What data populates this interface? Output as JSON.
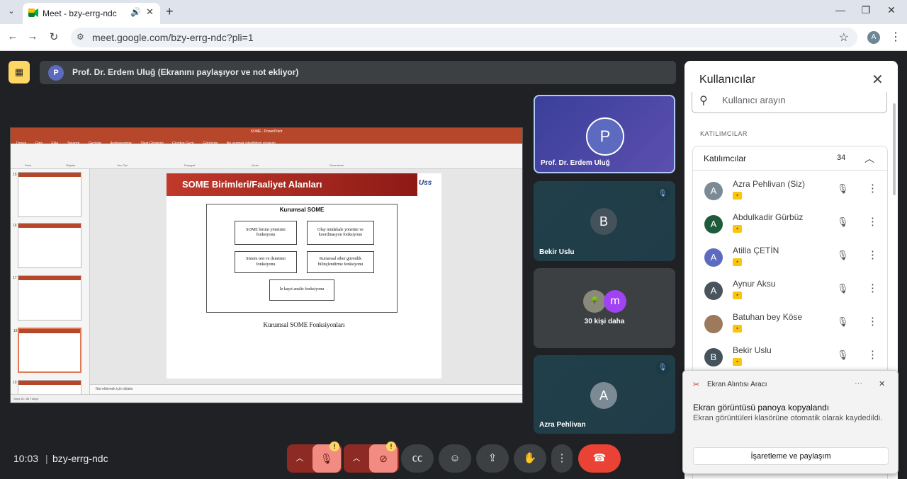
{
  "browser": {
    "tab_title": "Meet - bzy-errg-ndc",
    "url": "meet.google.com/bzy-errg-ndc?pli=1",
    "profile_initial": "A"
  },
  "presenter": {
    "initial": "P",
    "text": "Prof. Dr. Erdem Uluğ (Ekranını paylaşıyor ve not ekliyor)"
  },
  "shared_screen": {
    "window_title": "SOME - PowerPoint",
    "menu": [
      "Dosya",
      "Giriş",
      "Ekle",
      "Tasarım",
      "Geçişler",
      "Animasyonlar",
      "Slayt Gösterisi",
      "Gözden Geçir",
      "Görünüm",
      "Ne yapmak istediğinizi söyleyin..."
    ],
    "ribbon_groups": [
      "Pano",
      "Slaytlar",
      "Yazı Tipi",
      "Paragraf",
      "Çizim",
      "Düzenleme"
    ],
    "thumb_numbers": [
      "15",
      "16",
      "17",
      "18",
      "19"
    ],
    "slide": {
      "title": "SOME Birimleri/Faaliyet Alanları",
      "logo": "Uss",
      "box_title": "Kurumsal SOME",
      "boxes": [
        "SOME birimi yönetimi fonksiyonu",
        "Olay müdahale yönetim ve koordinasyon fonksiyonu",
        "Sistem test ve denetimi fonksiyonu",
        "Kurumsal siber güvenlik bilinçlendirme fonksiyonu",
        "İz kayıt analiz fonksiyonu"
      ],
      "caption": "Kurumsal SOME Fonksiyonları"
    },
    "notes": "Not eklemek için tıklatın",
    "status": "Slayt 18 / 56   Türkçe"
  },
  "tiles": [
    {
      "name": "Prof. Dr. Erdem Uluğ",
      "initial": "P"
    },
    {
      "name": "Bekir Uslu",
      "initial": "B"
    },
    {
      "name": "30 kişi daha",
      "initial": "m"
    },
    {
      "name": "Azra Pehlivan",
      "initial": "A"
    }
  ],
  "panel": {
    "title": "Kullanıcılar",
    "search_placeholder": "Kullanıcı arayın",
    "section_label": "KATILIMCILAR",
    "list_label": "Katılımcılar",
    "count": "34",
    "people": [
      {
        "name": "Azra Pehlivan (Siz)",
        "initial": "A",
        "color": "#7b8a95"
      },
      {
        "name": "Abdulkadir Gürbüz",
        "initial": "A",
        "color": "#1e5b3a"
      },
      {
        "name": "Atilla ÇETİN",
        "initial": "A",
        "color": "#5c6bc0"
      },
      {
        "name": "Aynur Aksu",
        "initial": "A",
        "color": "#4a545c"
      },
      {
        "name": "Batuhan bey Köse",
        "initial": "",
        "color": "#9c7a5c"
      },
      {
        "name": "Bekir Uslu",
        "initial": "B",
        "color": "#44525c"
      }
    ]
  },
  "toast": {
    "app": "Ekran Alıntısı Aracı",
    "heading": "Ekran görüntüsü panoya kopyalandı",
    "body": "Ekran görüntüleri klasörüne otomatik olarak kaydedildi.",
    "button": "İşaretleme ve paylaşım"
  },
  "meeting": {
    "time": "10:03",
    "separator": "|",
    "code": "bzy-errg-ndc"
  },
  "colors": {
    "accent_red": "#ea4335",
    "present_yellow": "#fdd663",
    "powerpoint_red": "#b7472a"
  }
}
